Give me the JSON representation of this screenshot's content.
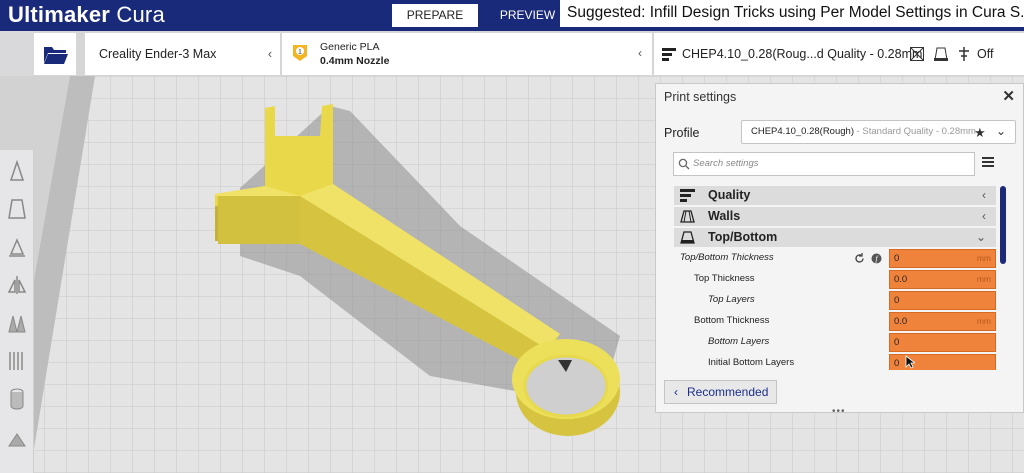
{
  "header": {
    "brand_bold": "Ultimaker",
    "brand_rest": " Cura",
    "tabs": [
      {
        "label": "PREPARE",
        "active": true
      },
      {
        "label": "PREVIEW",
        "active": false
      }
    ],
    "suggested_banner": "Suggested: Infill Design Tricks using Per Model Settings in Cura S..."
  },
  "config_bar": {
    "printer_name": "Creality Ender-3 Max",
    "material_badge": "1",
    "material_name": "Generic PLA",
    "nozzle": "0.4mm Nozzle",
    "print_settings_summary": "CHEP4.10_0.28(Roug...d Quality - 0.28mm",
    "support_state": "Off"
  },
  "toolbar": {
    "tools": [
      "move-tool-icon",
      "scale-tool-icon",
      "rotate-tool-icon",
      "mirror-tool-icon",
      "per-model-settings-icon",
      "support-blocker-icon",
      "tree-support-icon",
      "cylinder-tool-icon",
      "eraser-tool-icon"
    ]
  },
  "print_settings": {
    "title": "Print settings",
    "profile_label": "Profile",
    "profile_value": "CHEP4.10_0.28(Rough)",
    "profile_suffix": " - Standard Quality - 0.28mm",
    "search_placeholder": "Search settings",
    "categories": [
      {
        "name": "Quality",
        "expanded": false
      },
      {
        "name": "Walls",
        "expanded": false
      },
      {
        "name": "Top/Bottom",
        "expanded": true
      }
    ],
    "settings": [
      {
        "label": "Top/Bottom Thickness",
        "value": "0",
        "unit": "mm"
      },
      {
        "label": "Top Thickness",
        "value": "0.0",
        "unit": "mm"
      },
      {
        "label": "Top Layers",
        "value": "0",
        "unit": ""
      },
      {
        "label": "Bottom Thickness",
        "value": "0.0",
        "unit": "mm"
      },
      {
        "label": "Bottom Layers",
        "value": "0",
        "unit": ""
      },
      {
        "label": "Initial Bottom Layers",
        "value": "0",
        "unit": ""
      }
    ],
    "recommended_label": "Recommended",
    "value_color": "#f0833b",
    "brand_color": "#1a2a7a"
  }
}
